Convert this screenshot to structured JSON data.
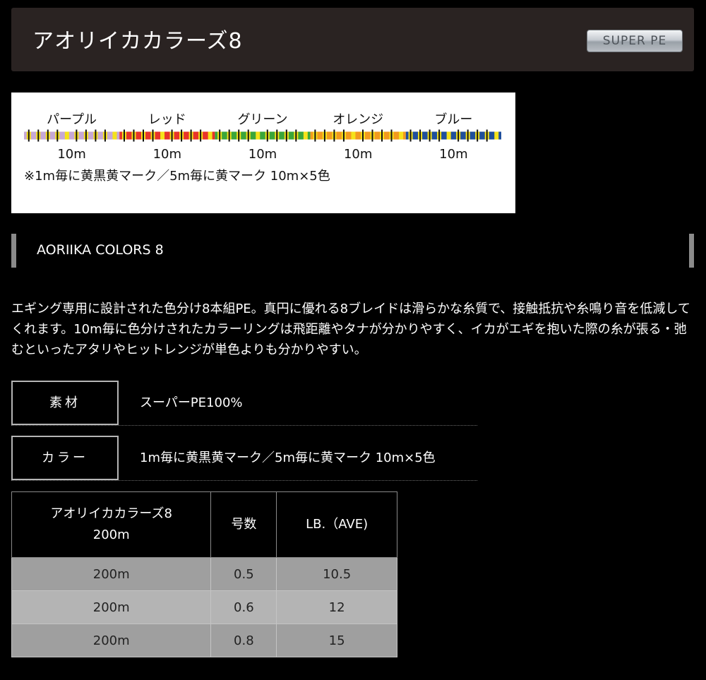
{
  "header": {
    "title": "アオリイカカラーズ8",
    "badge": "SUPER PE"
  },
  "diagram": {
    "segments": [
      {
        "name": "パープル",
        "length": "10m",
        "color": "#c6a8d6"
      },
      {
        "name": "レッド",
        "length": "10m",
        "color": "#e8332a"
      },
      {
        "name": "グリーン",
        "length": "10m",
        "color": "#3aa63a"
      },
      {
        "name": "オレンジ",
        "length": "10m",
        "color": "#f39a1e"
      },
      {
        "name": "ブルー",
        "length": "10m",
        "color": "#1f4f9c"
      }
    ],
    "note": "※1m毎に黄黒黄マーク／5m毎に黄マーク 10m×5色",
    "mark_yellow": "#f5e21a",
    "mark_black": "#111111"
  },
  "section": {
    "name": "AORIIKA COLORS 8"
  },
  "description": "エギング専用に設計された色分け8本組PE。真円に優れる8ブレイドは滑らかな糸質で、接触抵抗や糸鳴り音を低減してくれます。10m毎に色分けされたカラーリングは飛距離やタナが分かりやすく、イカがエギを抱いた際の糸が張る・弛むといったアタリやヒットレンジが単色よりも分かりやすい。",
  "specs": [
    {
      "label": "素材",
      "value": "スーパーPE100%"
    },
    {
      "label": "カラー",
      "value": "1m毎に黄黒黄マーク／5m毎に黄マーク 10m×5色"
    }
  ],
  "table": {
    "headers": [
      "アオリイカカラーズ8\n200m",
      "号数",
      "LB.（AVE)"
    ],
    "rows": [
      [
        "200m",
        "0.5",
        "10.5"
      ],
      [
        "200m",
        "0.6",
        "12"
      ],
      [
        "200m",
        "0.8",
        "15"
      ]
    ]
  }
}
